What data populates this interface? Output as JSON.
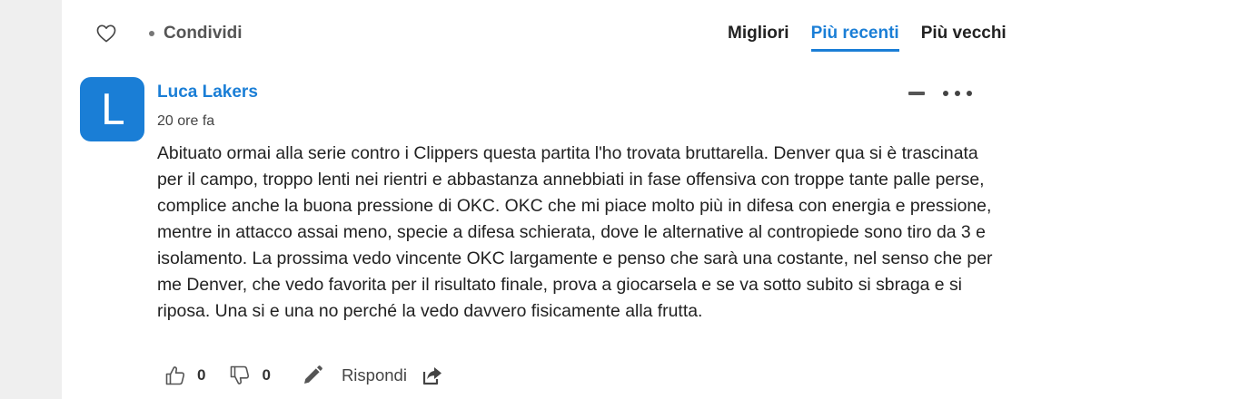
{
  "topbar": {
    "share_label": "Condividi",
    "sort_tabs": [
      {
        "label": "Migliori",
        "active": false
      },
      {
        "label": "Più recenti",
        "active": true
      },
      {
        "label": "Più vecchi",
        "active": false
      }
    ]
  },
  "comment": {
    "avatar_letter": "L",
    "author": "Luca Lakers",
    "time": "20 ore fa",
    "text": "Abituato ormai alla serie contro i Clippers questa partita l'ho trovata bruttarella. Denver qua si è trascinata per il campo, troppo lenti nei rientri e abbastanza annebbiati in fase offensiva con troppe tante palle perse, complice anche la buona pressione di OKC. OKC che mi piace molto più in difesa con energia e pressione, mentre in attacco assai meno, specie a difesa schierata, dove le alternative al contropiede sono tiro da 3 e isolamento. La prossima vedo vincente OKC largamente e penso che sarà una costante, nel senso che per me Denver, che vedo favorita per il risultato finale, prova a giocarsela e se va sotto subito si sbraga e si riposa. Una si e una no perché la vedo davvero fisicamente alla frutta.",
    "upvotes": "0",
    "downvotes": "0",
    "reply_label": "Rispondi"
  },
  "colors": {
    "accent": "#1a7ed6",
    "gutter": "#efefef"
  },
  "icons": [
    "heart-icon",
    "thumbs-up-icon",
    "thumbs-down-icon",
    "pencil-icon",
    "share-icon"
  ]
}
